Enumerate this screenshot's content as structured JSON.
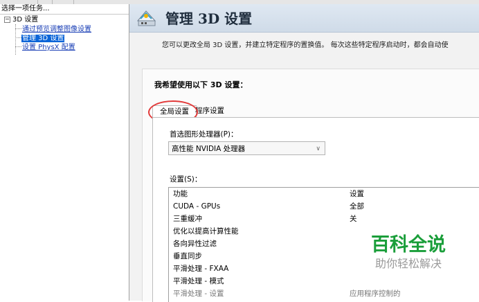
{
  "left_pane": {
    "header": "选择一项任务...",
    "tree": {
      "root_label": "3D 设置",
      "items": [
        {
          "label": "通过预览调整图像设置"
        },
        {
          "label": "管理 3D 设置"
        },
        {
          "label": "设置 PhysX 配置"
        }
      ]
    }
  },
  "banner": {
    "title": "管理 3D 设置",
    "icon": "nvidia-3d-settings-icon"
  },
  "description": "您可以更改全局 3D 设置，并建立特定程序的置换值。 每次这些特定程序启动时，都会自动使",
  "panel": {
    "heading": "我希望使用以下 3D 设置：",
    "tabs": [
      {
        "label": "全局设置",
        "selected": true
      },
      {
        "label": "程序设置",
        "selected": false
      }
    ],
    "gpu_label": "首选图形处理器(P)：",
    "gpu_value": "高性能 NVIDIA 处理器",
    "settings_label": "设置(S)：",
    "table": {
      "headers": [
        "功能",
        "设置"
      ],
      "rows": [
        {
          "feature": "CUDA - GPUs",
          "value": "全部"
        },
        {
          "feature": "三重缓冲",
          "value": "关"
        },
        {
          "feature": "优化以提高计算性能",
          "value": ""
        },
        {
          "feature": "各向异性过滤",
          "value": ""
        },
        {
          "feature": "垂直同步",
          "value": ""
        },
        {
          "feature": "平滑处理 - FXAA",
          "value": ""
        },
        {
          "feature": "平滑处理 - 模式",
          "value": ""
        },
        {
          "feature": "平滑处理 - 设置",
          "value": "应用程序控制的"
        }
      ]
    }
  },
  "watermark": {
    "title": "百科全说",
    "subtitle": "助你轻松解决"
  },
  "colors": {
    "selection": "#0a64d8",
    "link": "#1a3fb6",
    "highlight_circle": "#e23a3a",
    "watermark_green": "#1a9e3a"
  }
}
